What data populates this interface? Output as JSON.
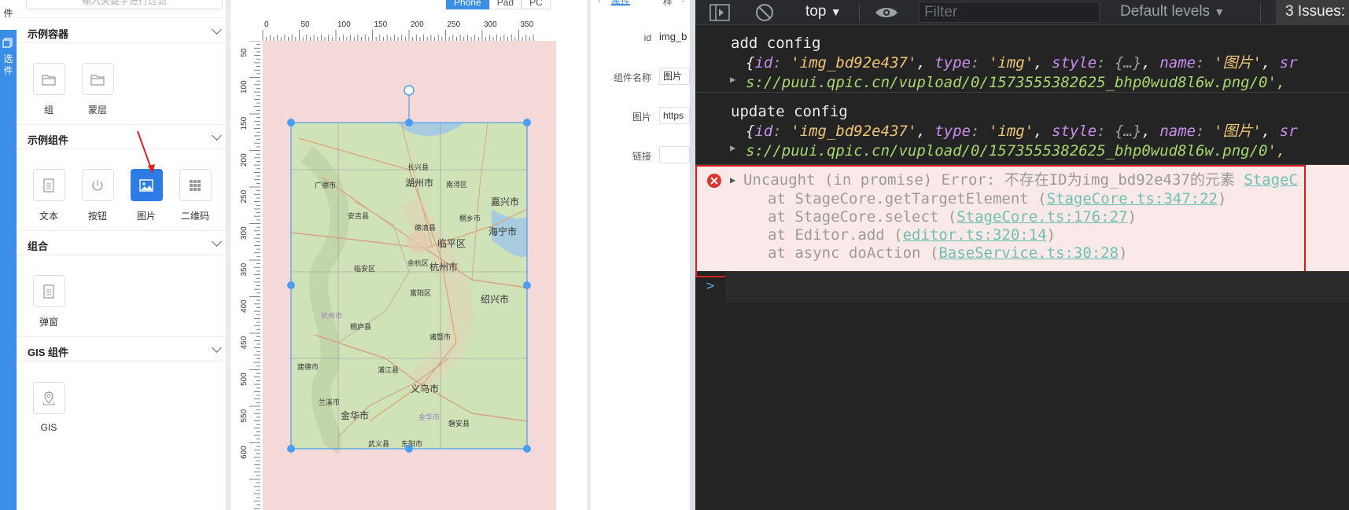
{
  "sidebar_strip": {
    "top_label": "件",
    "active_label_1": "选",
    "active_label_2": "件"
  },
  "panel": {
    "search_placeholder": "输入关键字进行过滤",
    "groups": [
      {
        "title": "示例容器",
        "items": [
          {
            "label": "组",
            "icon": "folder-icon"
          },
          {
            "label": "蒙层",
            "icon": "folder-icon"
          }
        ]
      },
      {
        "title": "示例组件",
        "items": [
          {
            "label": "文本",
            "icon": "document-icon"
          },
          {
            "label": "按钮",
            "icon": "power-icon"
          },
          {
            "label": "图片",
            "icon": "image-icon",
            "active": true
          },
          {
            "label": "二维码",
            "icon": "grid-icon"
          }
        ]
      },
      {
        "title": "组合",
        "items": [
          {
            "label": "弹窗",
            "icon": "document-icon"
          }
        ]
      },
      {
        "title": "GIS 组件",
        "items": [
          {
            "label": "GIS",
            "icon": "map-pin-icon"
          }
        ]
      }
    ]
  },
  "canvas": {
    "device_tabs": [
      "Phone",
      "Pad",
      "PC"
    ],
    "active_device": "Phone",
    "top_ruler_labels": [
      "0",
      "50",
      "100",
      "150",
      "200",
      "250",
      "300",
      "350"
    ],
    "left_ruler_labels": [
      "50",
      "100",
      "150",
      "200",
      "250",
      "300",
      "350",
      "400",
      "450",
      "500",
      "550",
      "600"
    ],
    "map_labels": [
      "长兴县",
      "湖州市",
      "南浔区",
      "广德市",
      "安吉县",
      "德清县",
      "桐乡市",
      "嘉兴市",
      "海宁市",
      "临平区",
      "临安区",
      "余杭区",
      "杭州市",
      "富阳区",
      "绍兴市",
      "杭州市",
      "桐庐县",
      "诸暨市",
      "建德市",
      "浦江县",
      "义乌市",
      "兰溪市",
      "金华市",
      "金华市",
      "磐安县",
      "武义县",
      "东阳市"
    ]
  },
  "properties": {
    "tabs": [
      "属性",
      "样"
    ],
    "fields": [
      {
        "label": "id",
        "value": "img_b"
      },
      {
        "label": "组件名称",
        "value": "图片"
      },
      {
        "label": "图片",
        "value": "https"
      },
      {
        "label": "链接",
        "value": ""
      }
    ]
  },
  "devtools": {
    "context": "top",
    "filter_placeholder": "Filter",
    "levels": "Default levels",
    "issues": "3 Issues:",
    "messages": [
      {
        "title": "add config",
        "line1_parts": [
          "{",
          "id",
          ": ",
          "'img_bd92e437'",
          ", ",
          "type",
          ": ",
          "'img'",
          ", ",
          "style",
          ": ",
          "{…}",
          ", ",
          "name",
          ": ",
          "'图片'",
          ", ",
          "sr"
        ],
        "line2": "s://puui.qpic.cn/vupload/0/1573555382625_bhp0wud8l6w.png/0',"
      },
      {
        "title": "update config",
        "line1_parts": [
          "{",
          "id",
          ": ",
          "'img_bd92e437'",
          ", ",
          "type",
          ": ",
          "'img'",
          ", ",
          "style",
          ": ",
          "{…}",
          ", ",
          "name",
          ": ",
          "'图片'",
          ", ",
          "sr"
        ],
        "line2": "s://puui.qpic.cn/vupload/0/1573555382625_bhp0wud8l6w.png/0',"
      }
    ],
    "error": {
      "message": "Uncaught (in promise) Error: 不存在ID为img_bd92e437的元素",
      "source_link": "StageC",
      "stack": [
        {
          "at": "at StageCore.getTargetElement (",
          "link": "StageCore.ts:347:22",
          "end": ")"
        },
        {
          "at": "at StageCore.select (",
          "link": "StageCore.ts:176:27",
          "end": ")"
        },
        {
          "at": "at Editor.add (",
          "link": "editor.ts:320:14",
          "end": ")"
        },
        {
          "at": "at async doAction (",
          "link": "BaseService.ts:30:28",
          "end": ")"
        }
      ]
    },
    "prompt": ">"
  }
}
